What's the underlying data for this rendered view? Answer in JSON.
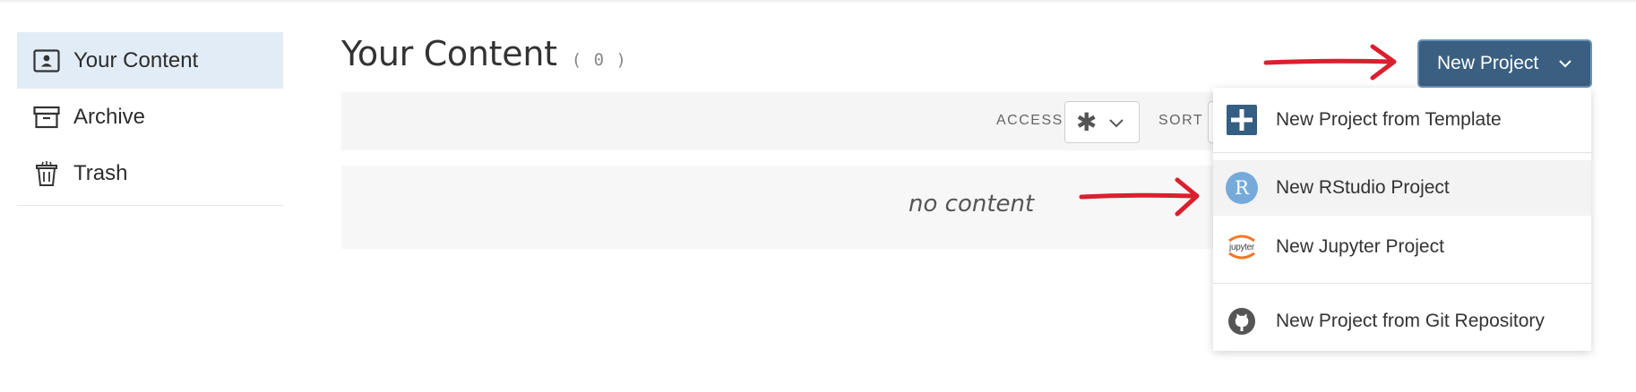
{
  "sidebar": {
    "items": [
      {
        "label": "Your Content",
        "icon": "user-card-icon",
        "active": true
      },
      {
        "label": "Archive",
        "icon": "archive-box-icon",
        "active": false
      },
      {
        "label": "Trash",
        "icon": "trash-can-icon",
        "active": false
      }
    ]
  },
  "main": {
    "title": "Your Content",
    "count": "( 0 )",
    "filters": {
      "access_label": "ACCESS",
      "access_value": "✱",
      "sort_label": "SORT"
    },
    "empty_text": "no content"
  },
  "new_project": {
    "button_label": "New Project",
    "menu": [
      {
        "label": "New Project from Template",
        "icon": "plus-square-icon"
      },
      {
        "label": "New RStudio Project",
        "icon": "rstudio-logo-icon",
        "icon_letter": "R"
      },
      {
        "label": "New Jupyter Project",
        "icon": "jupyter-logo-icon",
        "icon_text": "jupyter"
      },
      {
        "label": "New Project from Git Repository",
        "icon": "github-logo-icon"
      }
    ]
  },
  "colors": {
    "accent": "#3a5f80",
    "sidebar_active": "#e2ecf6",
    "annotation_arrow": "#d9202e",
    "rstudio_blue": "#75aadb",
    "template_icon": "#345e82"
  }
}
